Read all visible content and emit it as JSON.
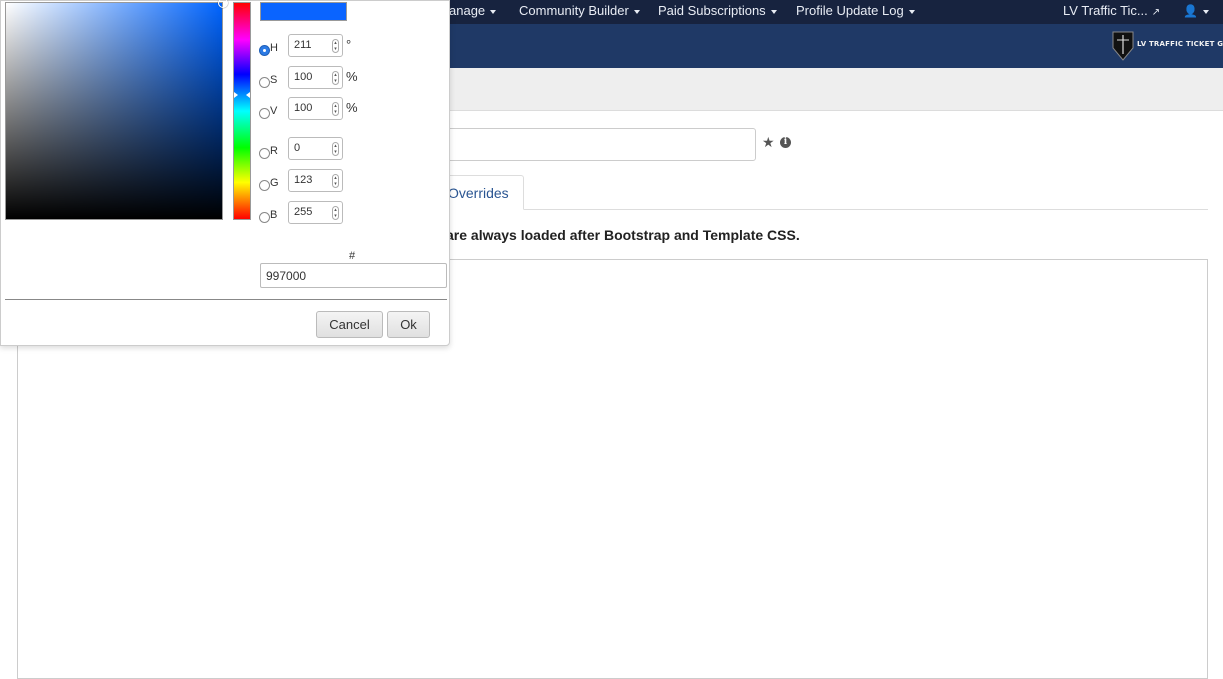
{
  "nav": {
    "items": [
      {
        "label": "anage"
      },
      {
        "label": "Community Builder"
      },
      {
        "label": "Paid Subscriptions"
      },
      {
        "label": "Profile Update Log"
      }
    ],
    "site_link": "LV Traffic Tic...",
    "icons": [
      "external-link-icon",
      "user-icon"
    ]
  },
  "logo": {
    "text": "LV TRAFFIC TICKET GUY"
  },
  "tabs": [
    {
      "label": "Overrides",
      "active": true
    }
  ],
  "note": "are always loaded after Bootstrap and Template CSS.",
  "color_picker": {
    "swatch_color": "#0a64ff",
    "fields": [
      {
        "letter": "H",
        "value": "211",
        "unit": "°",
        "checked": true
      },
      {
        "letter": "S",
        "value": "100",
        "unit": "%",
        "checked": false
      },
      {
        "letter": "V",
        "value": "100",
        "unit": "%",
        "checked": false
      },
      {
        "letter": "R",
        "value": "0",
        "unit": "",
        "checked": false
      },
      {
        "letter": "G",
        "value": "123",
        "unit": "",
        "checked": false
      },
      {
        "letter": "B",
        "value": "255",
        "unit": "",
        "checked": false
      }
    ],
    "hex_label": "#",
    "hex_value": "997000",
    "cancel_label": "Cancel",
    "ok_label": "Ok"
  },
  "colors": {
    "navbar": "#17233f",
    "header": "#1f3966",
    "accent": "#2c7be5"
  }
}
